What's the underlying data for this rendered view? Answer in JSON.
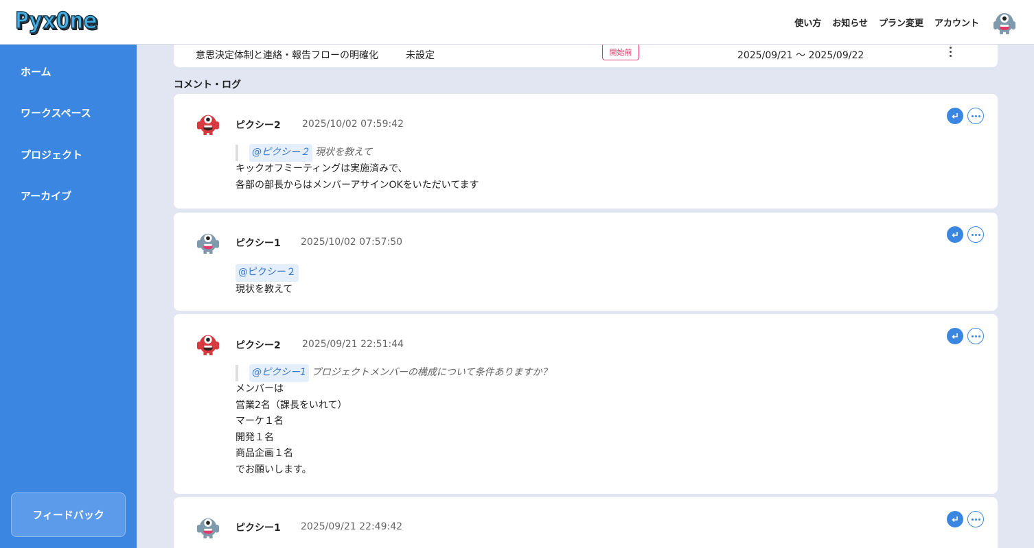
{
  "app": {
    "logo_text": "PyxOne"
  },
  "header": {
    "nav": [
      "使い方",
      "お知らせ",
      "プラン変更",
      "アカウント"
    ]
  },
  "sidebar": {
    "items": [
      "ホーム",
      "ワークスペース",
      "プロジェクト",
      "アーカイブ"
    ],
    "feedback": "フィードバック"
  },
  "task": {
    "title": "意思決定体制と連絡・報告フローの明確化",
    "assignee": "未設定",
    "status": "開始前",
    "dates": "2025/09/21 〜 2025/09/22"
  },
  "section_title": "コメント・ログ",
  "comments": [
    {
      "name": "ピクシー2",
      "time": "2025/10/02 07:59:42",
      "quote_mention": "@ピクシー２",
      "quote_text": "現状を教えて",
      "lines": [
        "キックオフミーティングは実施済みで、",
        "各部の部長からはメンバーアサインOKをいただいてます"
      ]
    },
    {
      "name": "ピクシー1",
      "time": "2025/10/02 07:57:50",
      "mention": "@ピクシー２",
      "lines": [
        "現状を教えて"
      ]
    },
    {
      "name": "ピクシー2",
      "time": "2025/09/21 22:51:44",
      "quote_mention": "@ピクシー1",
      "quote_text": "プロジェクトメンバーの構成について条件ありますか？",
      "lines": [
        "メンバーは",
        "営業2名（課長をいれて）",
        "マーケ１名",
        "開発１名",
        "商品企画１名",
        "でお願いします。"
      ]
    },
    {
      "name": "ピクシー1",
      "time": "2025/09/21 22:49:42"
    }
  ],
  "colors": {
    "accent": "#3a86e0",
    "status": "#e0356a",
    "mention": "#3a78c7"
  }
}
